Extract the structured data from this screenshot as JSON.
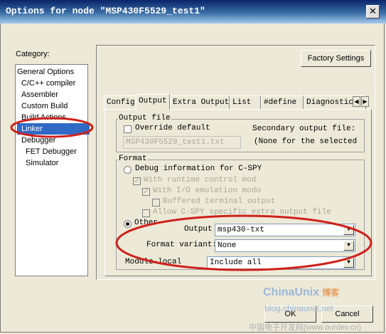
{
  "window": {
    "title": "Options for node \"MSP430F5529_test1\"",
    "close_glyph": "✕"
  },
  "category": {
    "label": "Category:",
    "items": [
      {
        "label": "General Options",
        "indent": false
      },
      {
        "label": "C/C++ compiler",
        "indent": true
      },
      {
        "label": "Assembler",
        "indent": true
      },
      {
        "label": "Custom Build",
        "indent": true
      },
      {
        "label": "Build Actions",
        "indent": true
      },
      {
        "label": "Linker",
        "indent": true,
        "selected": true
      },
      {
        "label": "Debugger",
        "indent": true
      },
      {
        "label": "FET Debugger",
        "indent": true
      },
      {
        "label": "Simulator",
        "indent": true
      }
    ]
  },
  "factory_settings": "Factory Settings",
  "tabs": [
    "Config",
    "Output",
    "Extra Output",
    "List",
    "#define",
    "Diagnostics"
  ],
  "active_tab": "Output",
  "output_file": {
    "group_label": "Output file",
    "override_label": "Override default",
    "filename": "MSP430F5529_test1.txt",
    "secondary_label": "Secondary output file:",
    "secondary_value": "(None for the selected fo"
  },
  "format": {
    "group_label": "Format",
    "debug_info": "Debug information for C-SPY",
    "runtime_control": "With runtime control mod",
    "io_emulation": "With I/O emulation modu",
    "buffered_output": "Buffered terminal output",
    "allow_cspy": "Allow C-SPY specific extra output file",
    "other_label": "Other",
    "output_label": "Output",
    "output_value": "msp430-txt",
    "variant_label": "Format variant:",
    "variant_value": "None",
    "module_local_label": "Module-local",
    "module_local_value": "Include all"
  },
  "buttons": {
    "ok": "OK",
    "cancel": "Cancel"
  },
  "watermark": {
    "brand": "ChinaUnix",
    "brand_cn": "博客",
    "blog": "blog.chinaunix.net",
    "footer": "中国电子开发网(www.ourdev.cn)"
  },
  "colors": {
    "annotation": "#d0201a",
    "selection": "#316ac5"
  },
  "icons": {
    "close": "close-icon",
    "combo": "chevron-down-icon",
    "tab_scroll": "arrow-icons"
  }
}
